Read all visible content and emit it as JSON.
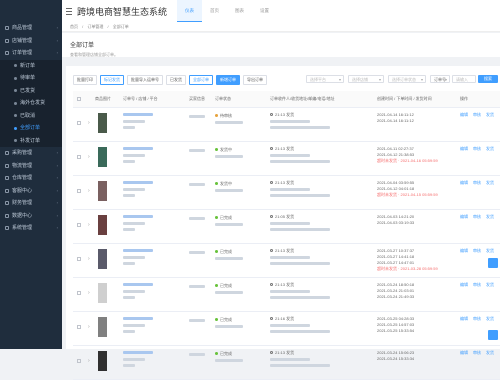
{
  "app": {
    "title": "跨境电商智慧生态系统"
  },
  "header_tabs": [
    {
      "label": "仪表",
      "active": true
    },
    {
      "label": "首页",
      "active": false
    },
    {
      "label": "图表",
      "active": false
    },
    {
      "label": "设置",
      "active": false
    }
  ],
  "sidebar": {
    "items": [
      {
        "label": "商品管理",
        "icon": "box-icon"
      },
      {
        "label": "店铺管理",
        "icon": "shop-icon"
      },
      {
        "label": "订单管理",
        "icon": "order-icon",
        "expanded": true
      }
    ],
    "subitems": [
      {
        "label": "新订单",
        "active": false
      },
      {
        "label": "待审单",
        "active": false
      },
      {
        "label": "已发货",
        "active": false
      },
      {
        "label": "海外仓发货",
        "active": false
      },
      {
        "label": "已取消",
        "active": false
      },
      {
        "label": "全部订单",
        "active": true
      },
      {
        "label": "补发订单",
        "active": false
      }
    ],
    "items2": [
      {
        "label": "采购管理",
        "icon": "cart-icon"
      },
      {
        "label": "物流管理",
        "icon": "truck-icon"
      },
      {
        "label": "仓库管理",
        "icon": "warehouse-icon"
      },
      {
        "label": "客服中心",
        "icon": "headset-icon"
      },
      {
        "label": "财务管理",
        "icon": "money-icon"
      },
      {
        "label": "数据中心",
        "icon": "chart-icon"
      },
      {
        "label": "系统管理",
        "icon": "gear-icon"
      }
    ]
  },
  "breadcrumb": [
    "首页",
    "/",
    "订单管理",
    "/",
    "全部订单"
  ],
  "page": {
    "title": "全部订单",
    "desc": "查看和管理店铺全部订单。"
  },
  "toolbar": {
    "buttons": [
      {
        "label": "批量打印",
        "style": "default"
      },
      {
        "label": "标记发货",
        "style": "outline"
      },
      {
        "label": "批量导入运单号",
        "style": "default"
      },
      {
        "label": "已发货",
        "style": "default"
      },
      {
        "label": "全部订单",
        "style": "outline"
      },
      {
        "label": "新增订单",
        "style": "primary"
      },
      {
        "label": "导出订单",
        "style": "default"
      }
    ],
    "filters": [
      {
        "placeholder": "选择平台"
      },
      {
        "placeholder": "选择店铺"
      },
      {
        "placeholder": "选择订单状态"
      },
      {
        "placeholder": "订单号"
      },
      {
        "placeholder": "请输入"
      }
    ],
    "search_label": "搜索"
  },
  "table": {
    "headers": [
      "商品图片",
      "订单号 / 店铺 / 平台",
      "买家信息",
      "订单状态",
      "订单收件人/收货地址/邮编/电话/地址",
      "创建时间 / 下单时间 / 发货时间",
      "操作"
    ],
    "rows": [
      {
        "status": "待审核",
        "status_color": "#e6a23c",
        "time": "21:13 发货",
        "dates": [
          "2021-04-14 16:11:12",
          "2021-04-14 16:11:12"
        ],
        "highlight": "",
        "actions": [
          "编辑",
          "审核",
          "发货"
        ]
      },
      {
        "status": "发货中",
        "status_color": "#67c23a",
        "time": "21:13 发货",
        "dates": [
          "2021-04-11 02:27:37",
          "2021-04-12 21:38:53"
        ],
        "highlight": "超时未发货 · 2021-04-16 05:59:59",
        "actions": [
          "编辑",
          "审核",
          "发货"
        ]
      },
      {
        "status": "发货中",
        "status_color": "#67c23a",
        "time": "21:13 发货",
        "dates": [
          "2021-04-04 03:59:55",
          "2021-04-12 04:01:18"
        ],
        "highlight": "超时未发货 · 2021-04-15 05:59:59",
        "actions": [
          "编辑",
          "审核",
          "发货"
        ]
      },
      {
        "status": "已完成",
        "status_color": "#67c23a",
        "time": "21:05 发货",
        "dates": [
          "2021-04-03 14:21:20",
          "2021-04-03 03:19:33"
        ],
        "highlight": "",
        "actions": [
          "编辑",
          "审核",
          "发货"
        ]
      },
      {
        "status": "已完成",
        "status_color": "#67c23a",
        "time": "21:13 发货",
        "dates": [
          "2021-03-27 10:37:37",
          "2021-03-27 14:41:18",
          "2021-03-27 14:47:01"
        ],
        "highlight": "超时未发货 · 2021-03-28 05:59:59",
        "actions": [
          "编辑",
          "审核",
          "发货"
        ]
      },
      {
        "status": "已完成",
        "status_color": "#67c23a",
        "time": "21:13 发货",
        "dates": [
          "2021-03-24 18:50:18",
          "2021-03-24 21:03:01",
          "2021-03-24 21:49:33"
        ],
        "highlight": "",
        "actions": [
          "编辑",
          "审核",
          "发货"
        ]
      },
      {
        "status": "已完成",
        "status_color": "#67c23a",
        "time": "21:16 发货",
        "dates": [
          "2021-03-25 04:28:33",
          "2021-03-25 14:57:03",
          "2021-03-25 15:33:54"
        ],
        "highlight": "",
        "actions": [
          "编辑",
          "审核",
          "发货"
        ]
      },
      {
        "status": "已完成",
        "status_color": "#67c23a",
        "time": "21:13 发货",
        "dates": [
          "2021-03-24 15:06:23",
          "2021-03-24 15:33:34"
        ],
        "highlight": "",
        "actions": [
          "编辑",
          "审核",
          "发货"
        ]
      }
    ]
  },
  "colors": {
    "accent": "#409eff",
    "sidebar": "#1f2d3d",
    "warning": "#f56c6c"
  }
}
